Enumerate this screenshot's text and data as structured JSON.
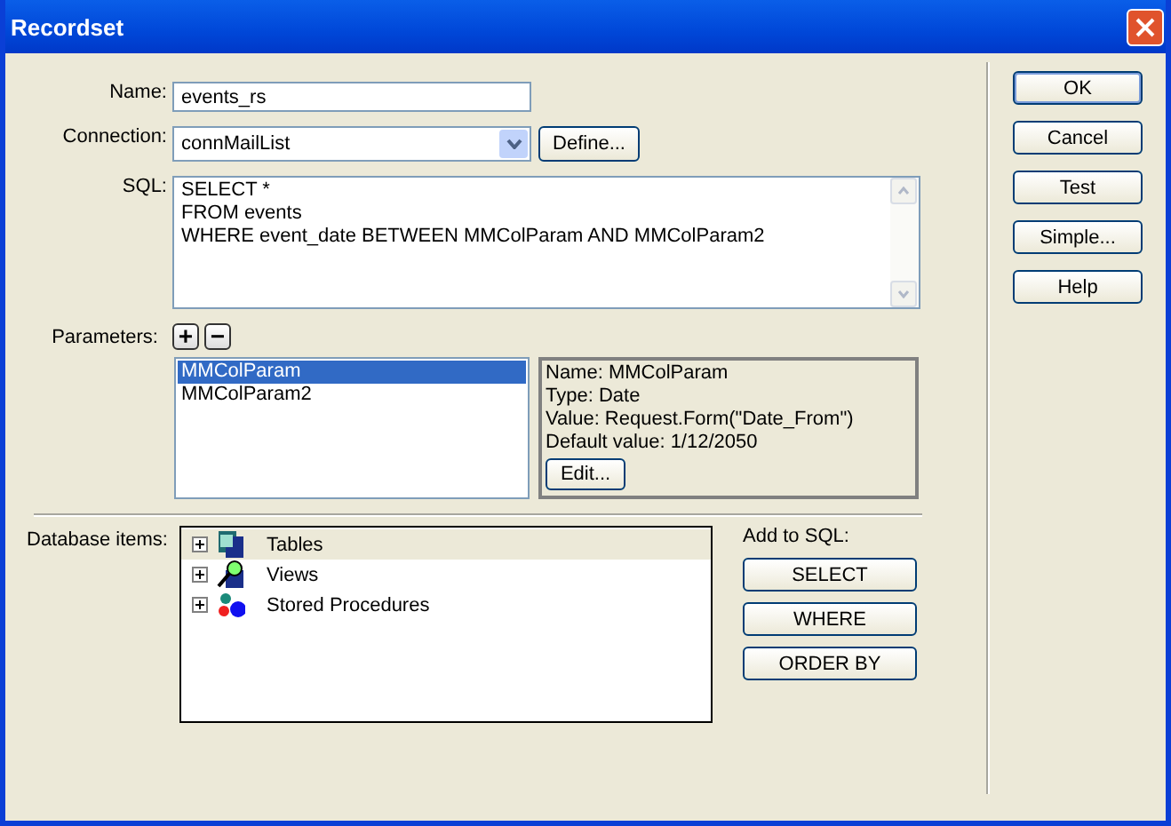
{
  "window": {
    "title": "Recordset"
  },
  "name": {
    "label": "Name:",
    "value": "events_rs"
  },
  "connection": {
    "label": "Connection:",
    "value": "connMailList",
    "define_button": "Define..."
  },
  "sql": {
    "label": "SQL:",
    "lines": [
      "SELECT *",
      "FROM events",
      "WHERE event_date BETWEEN MMColParam AND MMColParam2"
    ]
  },
  "parameters": {
    "label": "Parameters:",
    "add_button": "+",
    "remove_button": "−",
    "items": [
      {
        "label": "MMColParam",
        "selected": true
      },
      {
        "label": "MMColParam2",
        "selected": false
      }
    ],
    "details": [
      "Name: MMColParam",
      "Type: Date",
      "Value: Request.Form(\"Date_From\")",
      "Default value: 1/12/2050"
    ],
    "edit_button": "Edit..."
  },
  "database_items": {
    "label": "Database items:",
    "items": [
      {
        "label": "Tables",
        "expanded": false,
        "selected": true
      },
      {
        "label": "Views",
        "expanded": false,
        "selected": false
      },
      {
        "label": "Stored Procedures",
        "expanded": false,
        "selected": false
      }
    ]
  },
  "add_to_sql": {
    "label": "Add to SQL:",
    "buttons": [
      "SELECT",
      "WHERE",
      "ORDER BY"
    ]
  },
  "buttons": [
    {
      "label": "OK",
      "default": true
    },
    {
      "label": "Cancel",
      "default": false
    },
    {
      "label": "Test",
      "default": false
    },
    {
      "label": "Simple...",
      "default": false
    },
    {
      "label": "Help",
      "default": false
    }
  ]
}
